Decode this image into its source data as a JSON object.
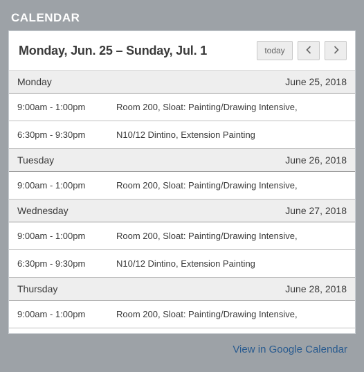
{
  "widget_title": "CALENDAR",
  "header": {
    "range": "Monday, Jun. 25 – Sunday, Jul. 1",
    "today_label": "today"
  },
  "days": [
    {
      "name": "Monday",
      "date": "June 25, 2018",
      "events": [
        {
          "time": "9:00am - 1:00pm",
          "title": "Room 200, Sloat: Painting/Drawing Intensive,"
        },
        {
          "time": "6:30pm - 9:30pm",
          "title": "N10/12 Dintino, Extension Painting"
        }
      ]
    },
    {
      "name": "Tuesday",
      "date": "June 26, 2018",
      "events": [
        {
          "time": "9:00am - 1:00pm",
          "title": "Room 200, Sloat: Painting/Drawing Intensive,"
        }
      ]
    },
    {
      "name": "Wednesday",
      "date": "June 27, 2018",
      "events": [
        {
          "time": "9:00am - 1:00pm",
          "title": "Room 200, Sloat: Painting/Drawing Intensive,"
        },
        {
          "time": "6:30pm - 9:30pm",
          "title": "N10/12 Dintino, Extension Painting"
        }
      ]
    },
    {
      "name": "Thursday",
      "date": "June 28, 2018",
      "events": [
        {
          "time": "9:00am - 1:00pm",
          "title": "Room 200, Sloat: Painting/Drawing Intensive,"
        }
      ]
    }
  ],
  "footer_link": "View in Google Calendar"
}
